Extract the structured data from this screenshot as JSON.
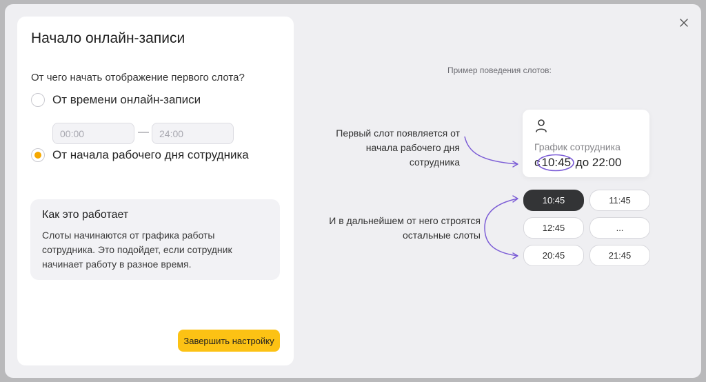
{
  "modal": {
    "title": "Начало онлайн-записи",
    "question": "От чего начать отображение первого слота?",
    "options": [
      {
        "label": "От времени онлайн-записи",
        "checked": false
      },
      {
        "label": "От начала рабочего дня сотрудника",
        "checked": true
      }
    ],
    "time_from_placeholder": "00:00",
    "time_to_placeholder": "24:00",
    "dash": "—",
    "info": {
      "title": "Как это работает",
      "text": "Слоты начинаются от графика работы сотрудника. Это подойдет, если сотрудник начинает работу в разное время."
    },
    "finish_button": "Завершить настройку",
    "close_icon": "close-icon"
  },
  "example": {
    "label": "Пример поведения слотов:",
    "card": {
      "icon": "person-icon",
      "title": "График сотрудника",
      "prefix": "с",
      "start": "10:45",
      "middle": "до",
      "end": "22:00"
    },
    "annotation_first": "Первый слот появляется от начала рабочего дня сотрудника",
    "annotation_rest": "И в дальнейшем от него строятся остальные слоты",
    "slots": [
      "10:45",
      "11:45",
      "12:45",
      "...",
      "20:45",
      "21:45"
    ],
    "active_slot": "10:45"
  },
  "colors": {
    "accent": "#fcc214",
    "radio_selected": "#f5a800",
    "arrow": "#7b5cd6",
    "slot_active": "#333436"
  }
}
